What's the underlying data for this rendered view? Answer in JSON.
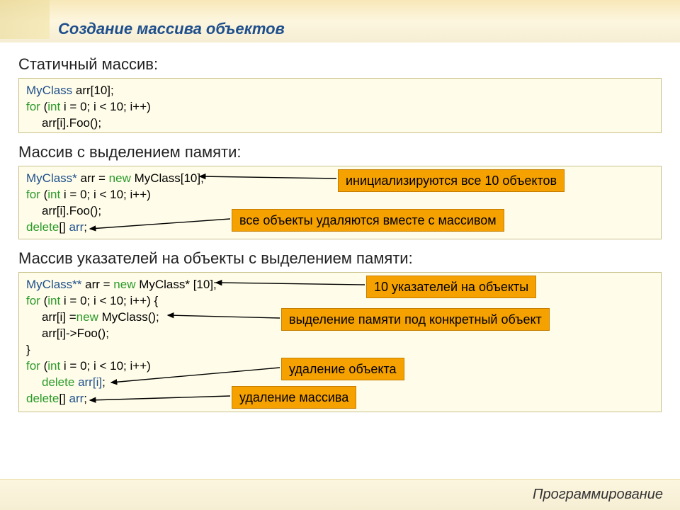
{
  "title": "Создание массива объектов",
  "footer": "Программирование",
  "sections": {
    "s1": {
      "label": "Статичный массив:"
    },
    "s2": {
      "label": "Массив с выделением памяти:"
    },
    "s3": {
      "label": "Массив указателей на объекты с выделением памяти:"
    }
  },
  "code1": {
    "l1_a": "MyClass",
    "l1_b": " arr[10];",
    "l2_a": "for",
    "l2_b": " (",
    "l2_c": "int",
    "l2_d": " i = 0; i < 10; i++)",
    "l3": "arr[i].Foo();"
  },
  "code2": {
    "l1_a": "MyClass*",
    "l1_b": " arr = ",
    "l1_c": "new",
    "l1_d": " MyClass[10];",
    "l2_a": "for",
    "l2_b": " (",
    "l2_c": "int",
    "l2_d": " i = 0; i < 10; i++)",
    "l3": "arr[i].Foo();",
    "l4_a": "delete",
    "l4_b": "[] ",
    "l4_c": "arr",
    "l4_d": ";"
  },
  "code3": {
    "l1_a": "MyClass**",
    "l1_b": " arr = ",
    "l1_c": "new",
    "l1_d": " MyClass* [10];",
    "l2_a": "for",
    "l2_b": " (",
    "l2_c": "int",
    "l2_d": " i = 0; i < 10; i++) {",
    "l3_a": "arr[i] = ",
    "l3_b": "new",
    "l3_c": " MyClass();",
    "l4": "arr[i]->Foo();",
    "l5": "}",
    "l6_a": "for",
    "l6_b": " (",
    "l6_c": "int",
    "l6_d": " i = 0; i < 10; i++)",
    "l7_a": "delete",
    "l7_b": " ",
    "l7_c": "arr[i]",
    "l7_d": ";",
    "l8_a": "delete",
    "l8_b": "[] ",
    "l8_c": "arr",
    "l8_d": ";"
  },
  "callouts": {
    "c1": "инициализируются все 10 объектов",
    "c2": "все объекты удаляются вместе с массивом",
    "c3": "10 указателей на объекты",
    "c4": "выделение памяти под конкретный объект",
    "c5": "удаление объекта",
    "c6": "удаление массива"
  }
}
